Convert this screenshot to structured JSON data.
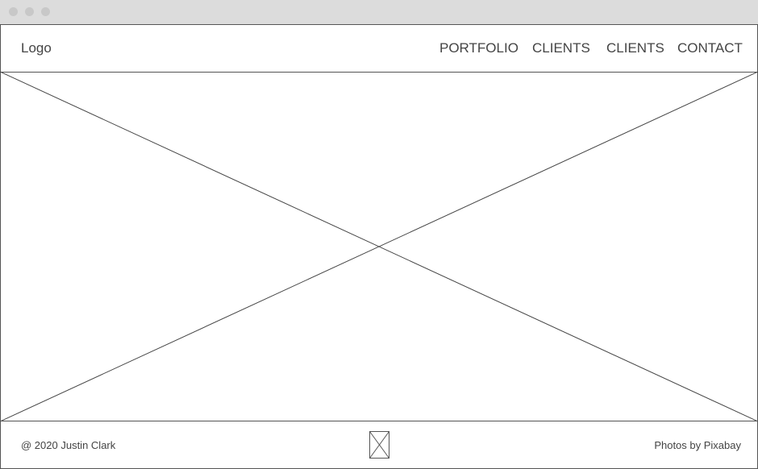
{
  "window": {
    "controls": [
      "close",
      "minimize",
      "maximize"
    ]
  },
  "header": {
    "logo": "Logo",
    "nav": [
      "PORTFOLIO",
      "CLIENTS",
      "CLIENTS",
      "CONTACT"
    ]
  },
  "hero": {
    "icon": "image-placeholder-icon"
  },
  "footer": {
    "copyright": "@ 2020 Justin Clark",
    "credit": "Photos by Pixabay",
    "icon": "image-placeholder-icon"
  }
}
